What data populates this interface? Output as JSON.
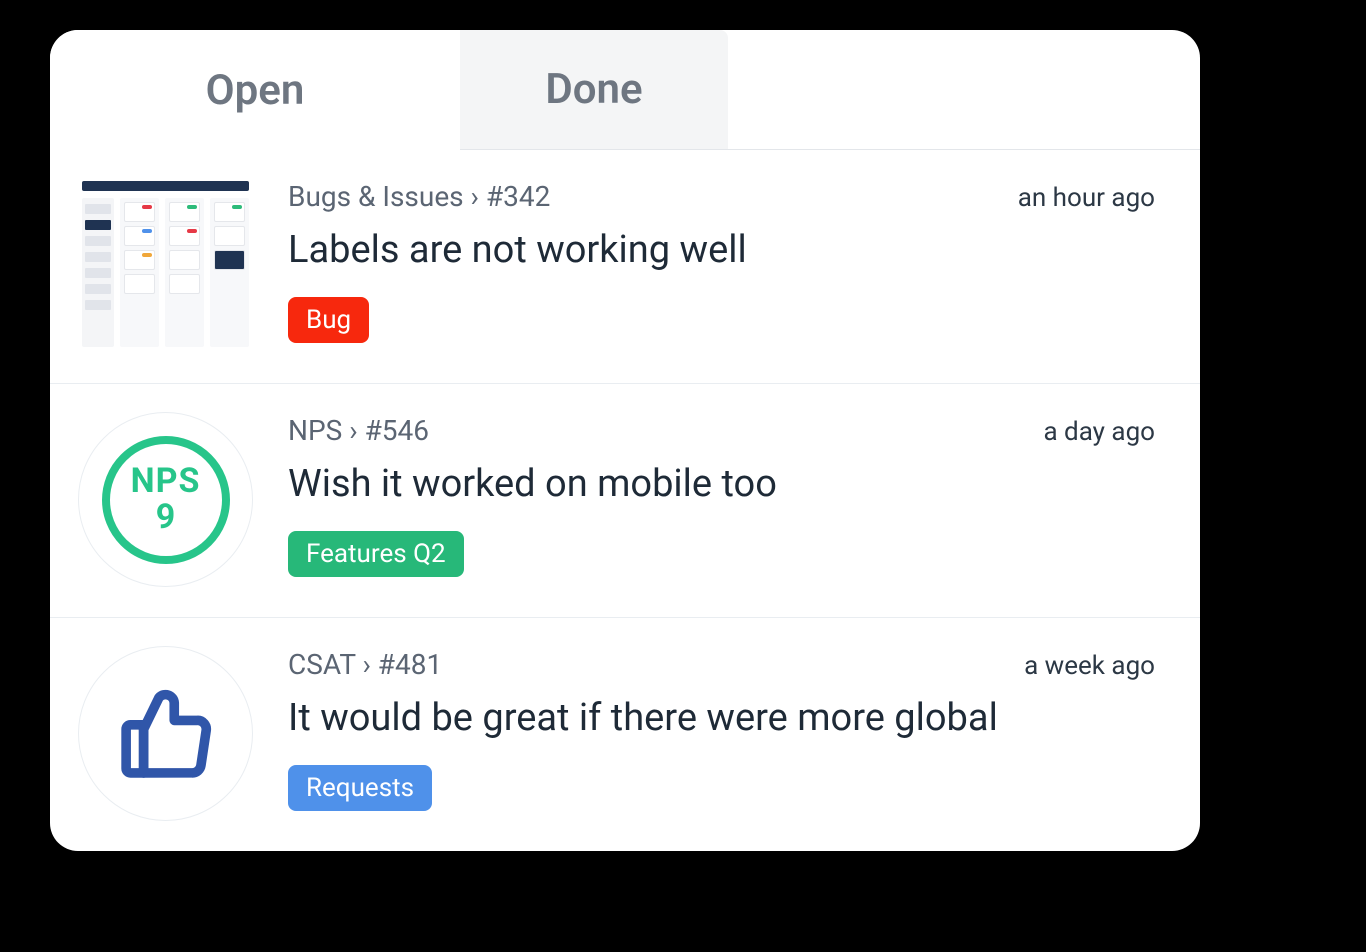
{
  "tabs": {
    "open": "Open",
    "done": "Done"
  },
  "items": [
    {
      "category": "Bugs & Issues",
      "ref": "#342",
      "breadcrumb": "Bugs & Issues › #342",
      "title": "Labels are not working well",
      "timestamp": "an hour ago",
      "tag": {
        "label": "Bug",
        "color": "red"
      },
      "thumb_type": "screenshot"
    },
    {
      "category": "NPS",
      "ref": "#546",
      "breadcrumb": "NPS › #546",
      "title": "Wish it worked on mobile too",
      "timestamp": "a day ago",
      "tag": {
        "label": "Features Q2",
        "color": "green"
      },
      "thumb_type": "nps",
      "nps": {
        "label": "NPS",
        "score": "9"
      }
    },
    {
      "category": "CSAT",
      "ref": "#481",
      "breadcrumb": "CSAT › #481",
      "title": "It would be great if there were more global",
      "timestamp": "a week ago",
      "tag": {
        "label": "Requests",
        "color": "blue"
      },
      "thumb_type": "thumbsup"
    }
  ]
}
